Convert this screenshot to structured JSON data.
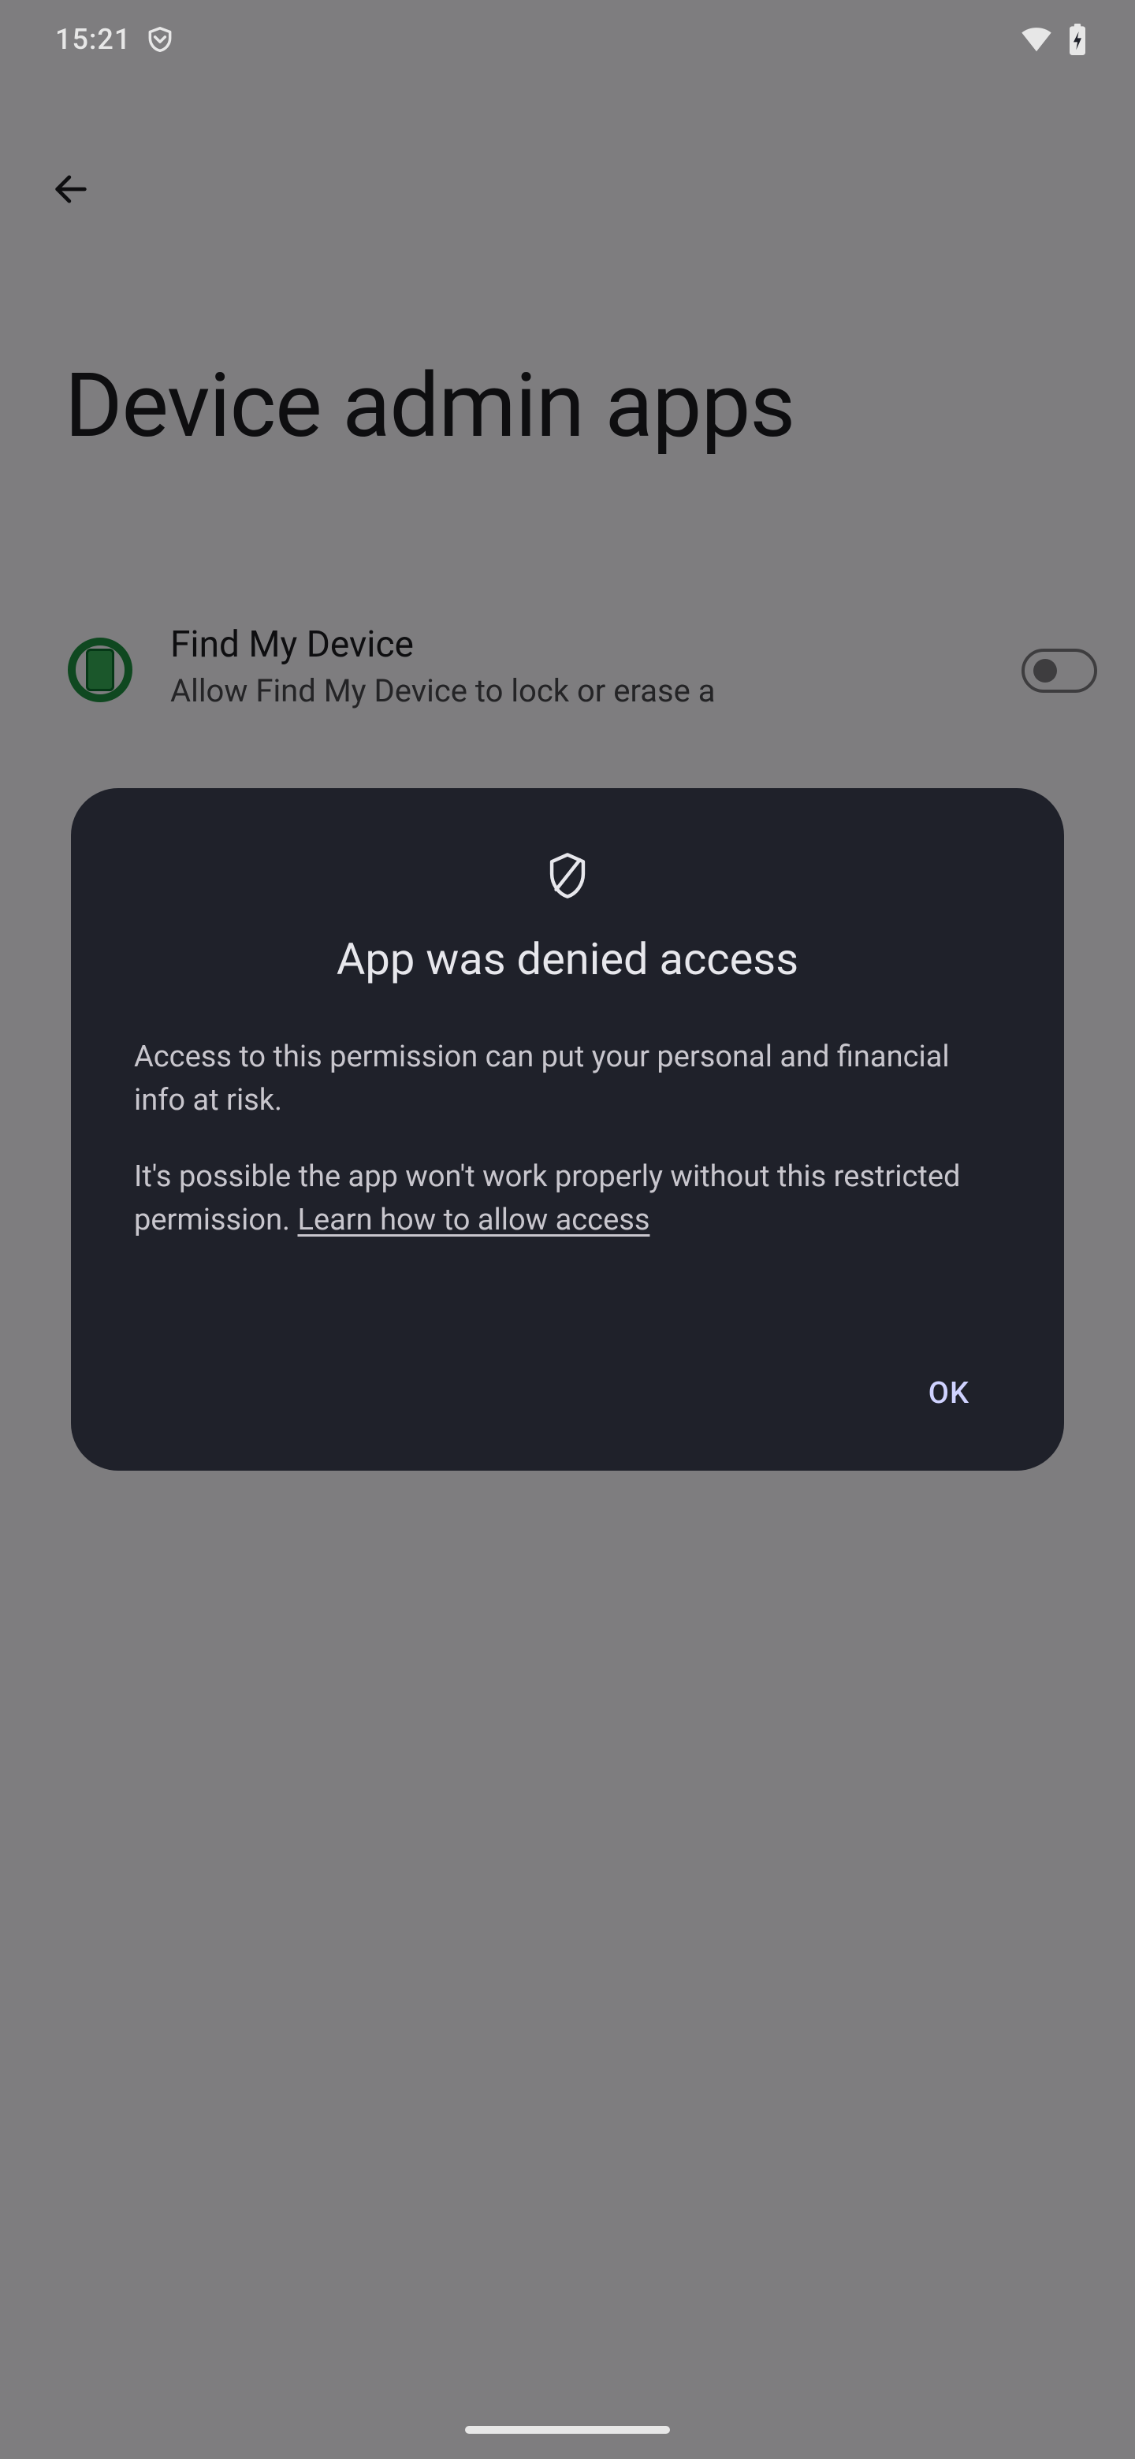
{
  "status": {
    "time": "15:21"
  },
  "page": {
    "title": "Device admin apps",
    "items": [
      {
        "title": "Find My Device",
        "subtitle": "Allow Find My Device to lock or erase a"
      }
    ]
  },
  "dialog": {
    "title": "App was denied access",
    "body_p1": "Access to this permission can put your personal and financial info at risk.",
    "body_p2a": "It's possible the app won't work properly without this restricted permission. ",
    "learn_link": "Learn how to allow access",
    "ok_label": "OK"
  }
}
